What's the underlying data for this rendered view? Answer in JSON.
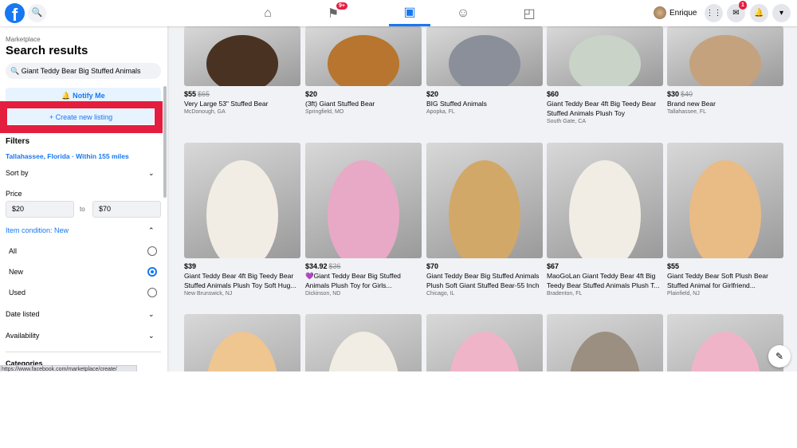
{
  "topbar": {
    "logo": "f",
    "user_name": "Enrique",
    "notifications_badge": "9+",
    "messenger_badge": "1",
    "nav": [
      {
        "icon": "home-icon",
        "glyph": "⌂"
      },
      {
        "icon": "flag-icon",
        "glyph": "⚑"
      },
      {
        "icon": "marketplace-icon",
        "glyph": "▣"
      },
      {
        "icon": "groups-icon",
        "glyph": "☺"
      },
      {
        "icon": "gaming-icon",
        "glyph": "◰"
      }
    ]
  },
  "sidebar": {
    "breadcrumb": "Marketplace",
    "title": "Search results",
    "search_value": "Giant Teddy Bear Big Stuffed Animals",
    "notify_label": "Notify Me",
    "create_label": "+ Create new listing",
    "filters_label": "Filters",
    "location": "Tallahassee, Florida · Within 155 miles",
    "sort_by": "Sort by",
    "price_label": "Price",
    "price_min": "$20",
    "price_to": "to",
    "price_max": "$70",
    "condition_label": "Item condition: New",
    "conditions": [
      {
        "label": "All",
        "selected": false
      },
      {
        "label": "New",
        "selected": true
      },
      {
        "label": "Used",
        "selected": false
      }
    ],
    "date_listed": "Date listed",
    "availability": "Availability",
    "categories": "Categories",
    "status_url": "https://www.facebook.com/marketplace/create/"
  },
  "accent": "#1877f2",
  "listings": [
    {
      "price": "$55",
      "old": "$65",
      "title": "Very Large 53\" Stuffed Bear",
      "loc": "McDonough, GA",
      "color": "#4a3222"
    },
    {
      "price": "$20",
      "old": "",
      "title": "(3ft) Giant Stuffed Bear",
      "loc": "Springfield, MO",
      "color": "#b8752f"
    },
    {
      "price": "$20",
      "old": "",
      "title": "BIG Stuffed Animals",
      "loc": "Apopka, FL",
      "color": "#8a8f99"
    },
    {
      "price": "$60",
      "old": "",
      "title": "Giant Teddy Bear 4ft Big Teedy Bear Stuffed Animals Plush Toy",
      "loc": "South Gate, CA",
      "color": "#c9d3c8"
    },
    {
      "price": "$30",
      "old": "$40",
      "title": "Brand new Bear",
      "loc": "Tallahassee, FL",
      "color": "#c4a27e"
    },
    {
      "price": "$39",
      "old": "",
      "title": "Giant Teddy Bear 4ft Big Teedy Bear Stuffed Animals Plush Toy Soft Hug...",
      "loc": "New Brunswick, NJ",
      "color": "#f2ede4"
    },
    {
      "price": "$34.92",
      "old": "$36",
      "title": "💜Giant Teddy Bear Big Stuffed Animals Plush Toy for Girls...",
      "loc": "Dickinson, ND",
      "color": "#e8a9c6"
    },
    {
      "price": "$70",
      "old": "",
      "title": "Giant Teddy Bear Big Stuffed Animals Plush Soft Giant Stuffed Bear-55 Inch",
      "loc": "Chicago, IL",
      "color": "#d2a868"
    },
    {
      "price": "$67",
      "old": "",
      "title": "MaoGoLan Giant Teddy Bear 4ft Big Teedy Bear Stuffed Animals Plush T...",
      "loc": "Bradenton, FL",
      "color": "#f2ede4"
    },
    {
      "price": "$55",
      "old": "",
      "title": "Giant Teddy Bear Soft Plush Bear Stuffed Animal for Girlfriend...",
      "loc": "Plainfield, NJ",
      "color": "#e9bb85"
    },
    {
      "color": "#efc590"
    },
    {
      "color": "#f2ede4"
    },
    {
      "color": "#f0b4c8"
    },
    {
      "color": "#9a8f80"
    },
    {
      "color": "#f0b4c8"
    }
  ]
}
